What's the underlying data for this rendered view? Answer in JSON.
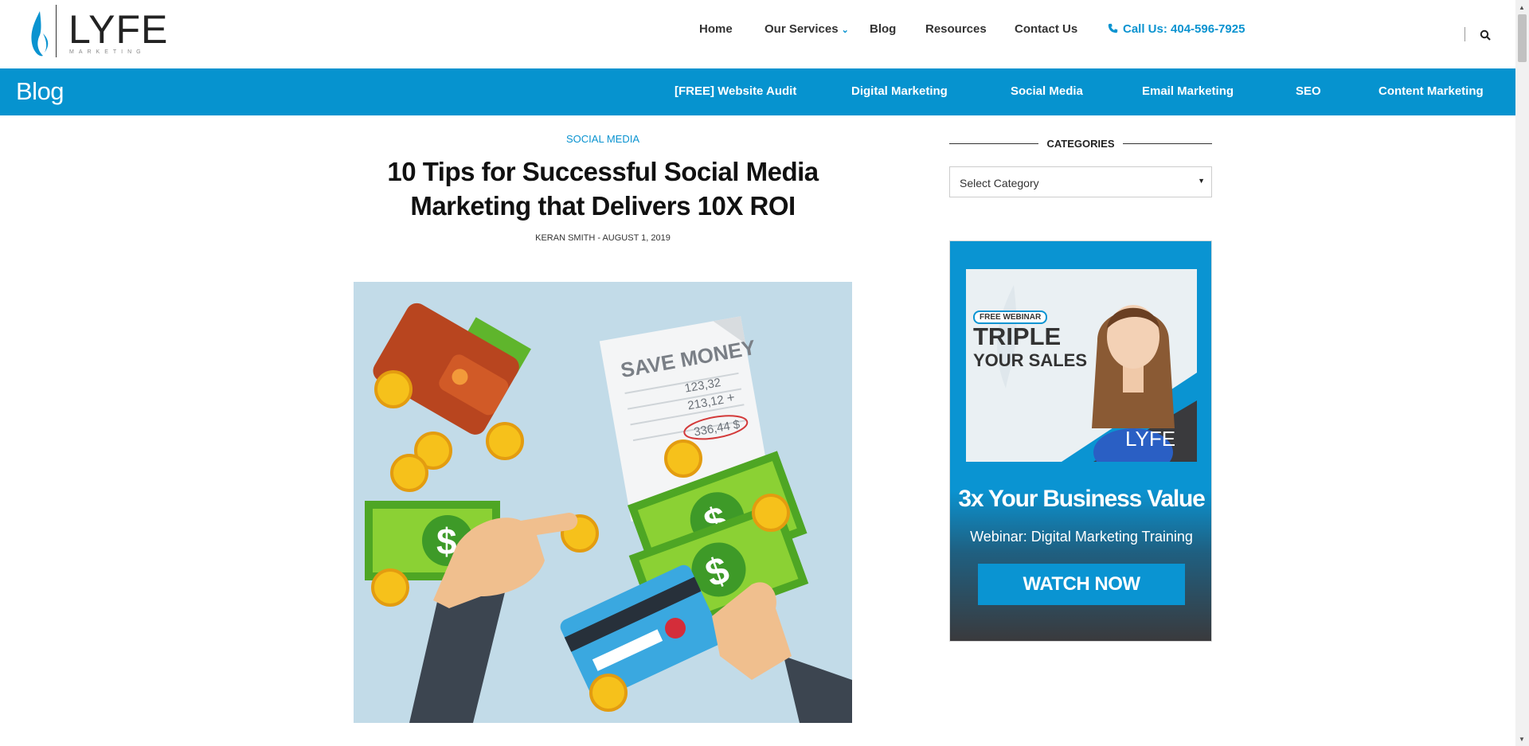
{
  "logo": {
    "wordmark": "LYFE",
    "sub": "MARKETING"
  },
  "topnav": {
    "home": "Home",
    "services": "Our Services",
    "blog": "Blog",
    "resources": "Resources",
    "contact": "Contact Us",
    "call": "Call Us: 404-596-7925"
  },
  "bluebar": {
    "title": "Blog",
    "items": [
      "[FREE] Website Audit",
      "Digital Marketing",
      "Social Media",
      "Email Marketing",
      "SEO",
      "Content Marketing"
    ]
  },
  "article": {
    "category": "SOCIAL MEDIA",
    "title": "10 Tips for Successful Social Media Marketing that Delivers 10X ROI",
    "byline": "KERAN SMITH - AUGUST 1, 2019",
    "hero_text": {
      "save_money": "SAVE MONEY",
      "line1": "123,32",
      "line2": "213,12",
      "plus": "+",
      "total": "336,44 $"
    }
  },
  "sidebar": {
    "categories_heading": "CATEGORIES",
    "select_value": "Select Category",
    "ad": {
      "badge": "FREE WEBINAR",
      "triple": "TRIPLE",
      "your_sales": "YOUR SALES",
      "logo": "LYFE",
      "headline": "3x Your Business Value",
      "sub": "Webinar: Digital Marketing Training",
      "button": "WATCH NOW"
    }
  },
  "colors": {
    "brand_blue": "#0693cf",
    "ad_dark": "#3a3a3d"
  }
}
